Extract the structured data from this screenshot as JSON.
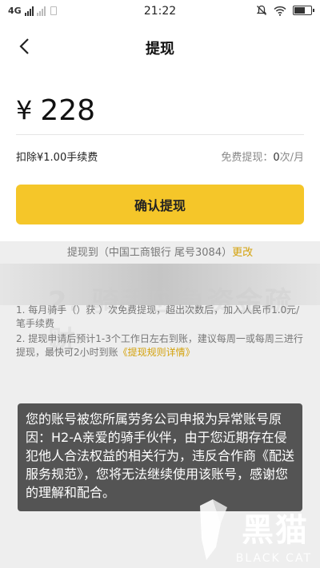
{
  "status_bar": {
    "network": "4G",
    "time": "21:22"
  },
  "nav": {
    "title": "提现"
  },
  "withdraw": {
    "currency": "¥",
    "amount": "228",
    "fee_text": "扣除¥1.00手续费",
    "free_label": "免费提现：",
    "free_count": "0",
    "free_unit": "次/月",
    "confirm_label": "确认提现",
    "bank_prefix": "提现到（中国工商银行 尾号3084）",
    "bank_change": "更改"
  },
  "watermark": {
    "title": "2. 骑手应急资金疏财"
  },
  "notes": {
    "n1": "1. 每月骑手（）获 ）次免费提现，超出次数后，加入人民币1.0元/笔手续费",
    "n2_prefix": "2. 提现申请后预计1-3个工作日左右到账，建议每周一或每周三进行提现，最快可2小时到账",
    "n2_link": "《提现规则详情》"
  },
  "toast": {
    "text": "您的账号被您所属劳务公司申报为异常账号原因：H2-A亲爱的骑手伙伴，由于您近期存在侵犯他人合法权益的相关行为，违反合作商《配送服务规范》，您将无法继续使用该账号，感谢您的理解和配合。"
  },
  "brand": {
    "cn": "黑猫",
    "en": "BLACK CAT"
  },
  "colors": {
    "accent": "#f5c629",
    "link": "#d4a20c"
  }
}
